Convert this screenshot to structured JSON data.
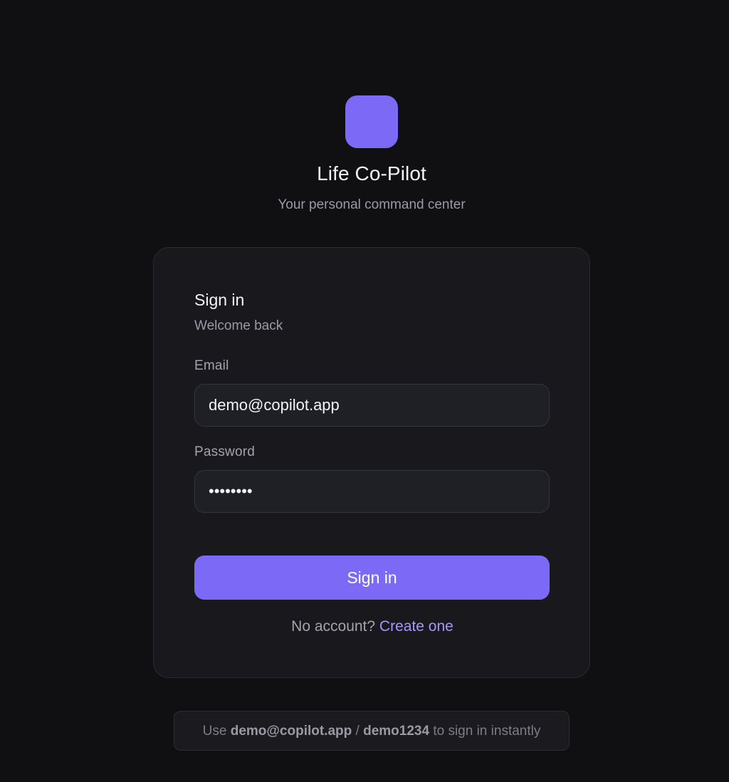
{
  "app": {
    "title": "Life Co-Pilot",
    "subtitle": "Your personal command center",
    "logo_icon": "app-logo-square",
    "accent_color": "#7c6af7"
  },
  "form": {
    "title": "Sign in",
    "subtitle": "Welcome back",
    "email": {
      "label": "Email",
      "value": "demo@copilot.app"
    },
    "password": {
      "label": "Password",
      "value": "demo1234"
    },
    "submit_label": "Sign in",
    "signup_prompt": "No account?",
    "signup_link": "Create one"
  },
  "hint": {
    "prefix": "Use",
    "email": "demo@copilot.app",
    "separator": "/",
    "password": "demo1234",
    "suffix": "to sign in instantly"
  }
}
